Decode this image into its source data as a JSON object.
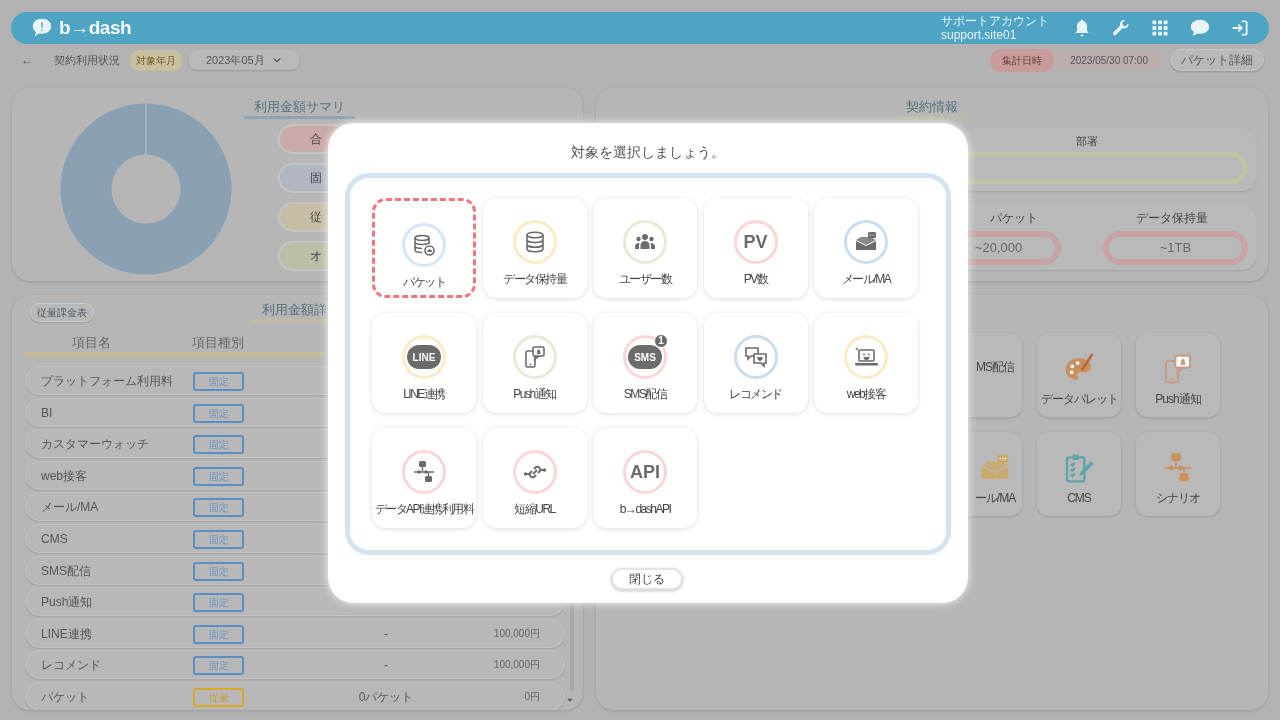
{
  "header": {
    "logo": "b→dash",
    "account_name": "サポートアカウント",
    "account_id": "support.site01"
  },
  "subbar": {
    "back": "←",
    "title": "契約利用状況",
    "period_tag": "対象年月",
    "period_value": "2023年05月",
    "aggregate_tag": "集計日時",
    "aggregate_value": "2023/05/30 07:00",
    "detail_button": "パケット詳細"
  },
  "summary": {
    "title": "利用金額サマリ",
    "pills": [
      {
        "label": "合",
        "color": "#caa9a9"
      },
      {
        "label": "固",
        "color": "#b0b6c2"
      },
      {
        "label": "従",
        "color": "#c6bea4"
      },
      {
        "label": "オ",
        "color": "#bcbea6"
      }
    ]
  },
  "detail": {
    "button": "従量課金表",
    "title": "利用金額詳",
    "columns": [
      "項目名",
      "項目種別"
    ],
    "rows": [
      {
        "name": "プラットフォーム利用料",
        "type": "固定",
        "kind": "fixed"
      },
      {
        "name": "BI",
        "type": "固定",
        "kind": "fixed"
      },
      {
        "name": "カスタマーウォッチ",
        "type": "固定",
        "kind": "fixed"
      },
      {
        "name": "web接客",
        "type": "固定",
        "kind": "fixed"
      },
      {
        "name": "メール/MA",
        "type": "固定",
        "kind": "fixed"
      },
      {
        "name": "CMS",
        "type": "固定",
        "kind": "fixed"
      },
      {
        "name": "SMS配信",
        "type": "固定",
        "kind": "fixed"
      },
      {
        "name": "Push通知",
        "type": "固定",
        "kind": "fixed"
      },
      {
        "name": "LINE連携",
        "type": "固定",
        "kind": "fixed",
        "quantity": "-",
        "amount": "100,000円"
      },
      {
        "name": "レコメンド",
        "type": "固定",
        "kind": "fixed",
        "quantity": "-",
        "amount": "100,000円"
      },
      {
        "name": "パケット",
        "type": "従量",
        "kind": "usage",
        "quantity": "0パケット",
        "amount": "0円"
      }
    ]
  },
  "contract": {
    "title": "契約情報",
    "department_label": "部署",
    "packet_label": "パケット",
    "packet_value": "~20,000",
    "storage_label": "データ保持量",
    "storage_value": "~1TB"
  },
  "features": [
    {
      "label": "MS配信",
      "kind": "sms"
    },
    {
      "label": "データパレット",
      "kind": "palette"
    },
    {
      "label": "Push通知",
      "kind": "push"
    },
    {
      "label": "ール/MA",
      "kind": "mail"
    },
    {
      "label": "CMS",
      "kind": "clipboard"
    },
    {
      "label": "シナリオ",
      "kind": "flow"
    }
  ],
  "modal": {
    "title": "対象を選択しましょう。",
    "close": "閉じる",
    "tiles": [
      {
        "label": "パケット",
        "kind": "database-chart",
        "color": "#d6e6f7",
        "selected": true
      },
      {
        "label": "データ保持量",
        "kind": "database",
        "color": "#f9ebc4",
        "selected": false
      },
      {
        "label": "ユーザー数",
        "kind": "people",
        "color": "#e4ebd6",
        "selected": false
      },
      {
        "label": "PV数",
        "kind": "text",
        "icon_text": "PV",
        "color": "#fbd6d6",
        "selected": false
      },
      {
        "label": "メール/MA",
        "kind": "mail",
        "color": "#c9ddef",
        "selected": false
      },
      {
        "label": "LINE連携",
        "kind": "line",
        "icon_text": "LINE",
        "color": "#f9ebc4",
        "selected": false
      },
      {
        "label": "Push通知",
        "kind": "push",
        "color": "#e4ebd6",
        "selected": false
      },
      {
        "label": "SMS配信",
        "kind": "sms",
        "icon_text": "SMS",
        "badge": "1",
        "color": "#fbd6d6",
        "selected": false
      },
      {
        "label": "レコメンド",
        "kind": "recommend",
        "color": "#c9ddef",
        "selected": false
      },
      {
        "label": "web接客",
        "kind": "web",
        "color": "#f9ebc4",
        "selected": false
      },
      {
        "label": "データAPI連携利用料",
        "kind": "flow",
        "color": "#fbd6d6",
        "selected": false
      },
      {
        "label": "短縮URL",
        "kind": "link",
        "color": "#fbd6d6",
        "selected": false
      },
      {
        "label": "b→dashAPI",
        "kind": "text",
        "icon_text": "API",
        "color": "#fbd6d6",
        "selected": false
      }
    ]
  }
}
